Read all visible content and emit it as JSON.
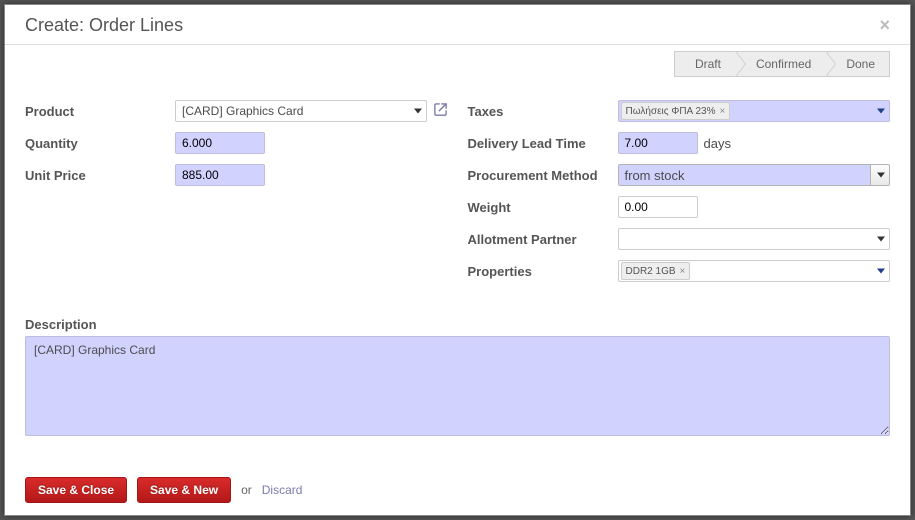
{
  "dialog": {
    "title": "Create: Order Lines"
  },
  "stages": {
    "s1": "Draft",
    "s2": "Confirmed",
    "s3": "Done"
  },
  "labels": {
    "product": "Product",
    "quantity": "Quantity",
    "unit_price": "Unit Price",
    "taxes": "Taxes",
    "delivery_lead_time": "Delivery Lead Time",
    "days_suffix": "days",
    "procurement_method": "Procurement Method",
    "weight": "Weight",
    "allotment_partner": "Allotment Partner",
    "properties": "Properties",
    "description": "Description"
  },
  "values": {
    "product": "[CARD] Graphics Card",
    "quantity": "6.000",
    "unit_price": "885.00",
    "tax_tag": "Πωλήσεις ΦΠΑ 23%",
    "delivery_lead_time": "7.00",
    "procurement_method": "from stock",
    "weight": "0.00",
    "allotment_partner": "",
    "property_tag": "DDR2 1GB",
    "description": "[CARD] Graphics Card"
  },
  "footer": {
    "save_close": "Save & Close",
    "save_new": "Save & New",
    "or": "or",
    "discard": "Discard"
  }
}
